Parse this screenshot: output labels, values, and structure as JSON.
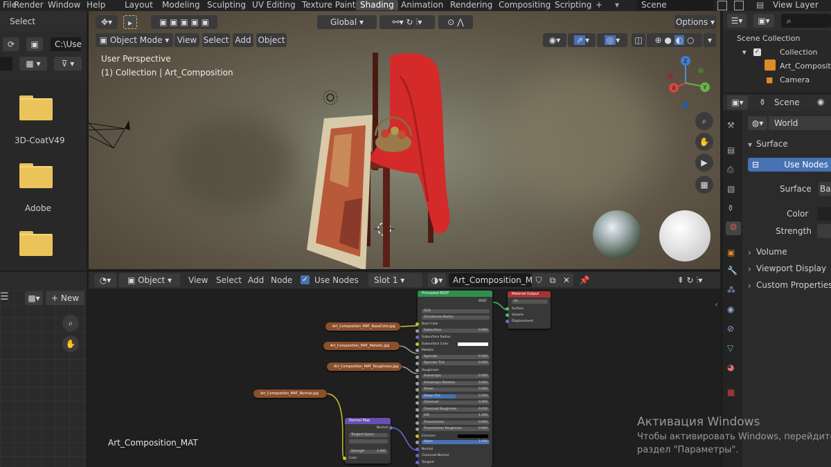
{
  "topbar": {
    "menus": [
      "File",
      "Render",
      "Window",
      "Help"
    ],
    "tabs": [
      "Layout",
      "Modeling",
      "Sculpting",
      "UV Editing",
      "Texture Paint",
      "Shading",
      "Animation",
      "Rendering",
      "Compositing",
      "Scripting"
    ],
    "active_tab": "Shading",
    "plus": "+",
    "scene_label": "Scene",
    "view_layer_label": "View Layer"
  },
  "file_browser": {
    "select_label": "Select",
    "path_value": "C:\\Use",
    "items": [
      {
        "label": ""
      },
      {
        "label": "3D-CoatV49"
      },
      {
        "label": "Adobe"
      },
      {
        "label": ""
      }
    ]
  },
  "viewport": {
    "orientation_label": "Global",
    "options_label": "Options",
    "mode_label": "Object Mode",
    "menu_items": [
      "View",
      "Select",
      "Add",
      "Object"
    ],
    "perspective_text": "User Perspective",
    "collection_text": "(1) Collection | Art_Composition",
    "gizmo": {
      "z": "Z",
      "x": "X",
      "y": "Y"
    }
  },
  "node_editor": {
    "editor_type_label": "Object",
    "menu_items": [
      "View",
      "Select",
      "Add",
      "Node"
    ],
    "use_nodes_label": "Use Nodes",
    "use_nodes_checked": true,
    "slot_label": "Slot 1",
    "material_name": "Art_Composition_MAT",
    "canvas_label": "Art_Composition_MAT",
    "image_nodes": [
      "Art_Composition_MAT_BaseColor.jpg",
      "Art_Composition_MAT_Metallic.jpg",
      "Art_Composition_MAT_Roughness.jpg",
      "Art_Composition_MAT_Normal.jpg"
    ],
    "bsdf": {
      "title": "Principled BSDF",
      "output": "BSDF",
      "distribution": "GGX",
      "subsurface_method": "Christensen-Burley",
      "rows": [
        {
          "label": "Base Color",
          "value": ""
        },
        {
          "label": "Subsurface",
          "value": "0.000"
        },
        {
          "label": "Subsurface Radius",
          "value": ""
        },
        {
          "label": "Subsurface Color",
          "value": ""
        },
        {
          "label": "Metallic",
          "value": ""
        },
        {
          "label": "Specular",
          "value": "0.500"
        },
        {
          "label": "Specular Tint",
          "value": "0.000"
        },
        {
          "label": "Roughness",
          "value": ""
        },
        {
          "label": "Anisotropic",
          "value": "0.000"
        },
        {
          "label": "Anisotropic Rotation",
          "value": "0.000"
        },
        {
          "label": "Sheen",
          "value": "0.000"
        },
        {
          "label": "Sheen Tint",
          "value": "0.500"
        },
        {
          "label": "Clearcoat",
          "value": "0.000"
        },
        {
          "label": "Clearcoat Roughness",
          "value": "0.030"
        },
        {
          "label": "IOR",
          "value": "1.450"
        },
        {
          "label": "Transmission",
          "value": "0.000"
        },
        {
          "label": "Transmission Roughness",
          "value": "0.000"
        },
        {
          "label": "Emission",
          "value": ""
        },
        {
          "label": "Alpha",
          "value": "1.000"
        },
        {
          "label": "Normal",
          "value": ""
        },
        {
          "label": "Clearcoat Normal",
          "value": ""
        },
        {
          "label": "Tangent",
          "value": ""
        }
      ]
    },
    "output_node": {
      "title": "Material Output",
      "target": "All",
      "sockets": [
        "Surface",
        "Volume",
        "Displacement"
      ]
    },
    "normal_map": {
      "title": "Normal Map",
      "output": "Normal",
      "space": "Tangent Space",
      "strength_label": "Strength",
      "strength_value": "1.000",
      "color_label": "Color"
    }
  },
  "image_editor": {
    "new_label": "New",
    "plus": "+"
  },
  "outliner": {
    "root": "Scene Collection",
    "collection": "Collection",
    "items": [
      "Art_Composition",
      "Camera"
    ]
  },
  "properties": {
    "scene_label": "Scene",
    "world_label": "World",
    "surface_section": "Surface",
    "use_nodes_label": "Use Nodes",
    "surface_label": "Surface",
    "surface_value": "Ba",
    "color_label": "Color",
    "strength_label": "Strength",
    "sections": [
      "Volume",
      "Viewport Display",
      "Custom Properties"
    ]
  },
  "watermark": {
    "title": "Активация Windows",
    "line1": "Чтобы активировать Windows, перейдите",
    "line2": "раздел \"Параметры\"."
  },
  "colors": {
    "accent": "#4772b3",
    "image_node": "#8a4f2b",
    "bsdf_header": "#2f8f4f",
    "output_header": "#a83232",
    "vector_header": "#6b4fb0",
    "drape_red": "#d42a2a"
  }
}
